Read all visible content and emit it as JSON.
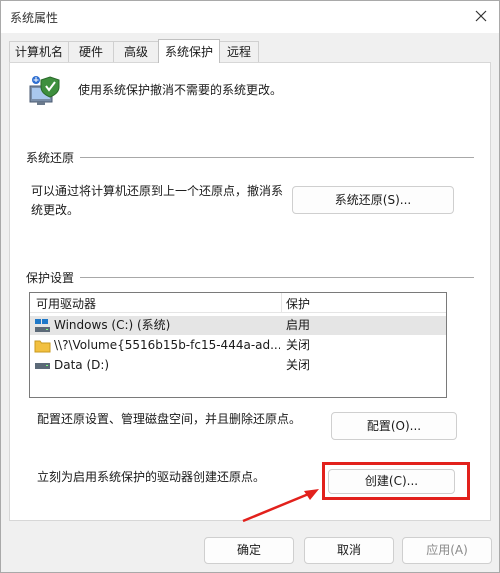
{
  "window": {
    "title": "系统属性"
  },
  "tabs": [
    {
      "label": "计算机名"
    },
    {
      "label": "硬件"
    },
    {
      "label": "高级"
    },
    {
      "label": "系统保护"
    },
    {
      "label": "远程"
    }
  ],
  "intro": {
    "text": "使用系统保护撤消不需要的系统更改。",
    "icon": "system-protection-shield-icon"
  },
  "restore": {
    "heading": "系统还原",
    "description_line1": "可以通过将计算机还原到上一个还原点，撤消系",
    "description_line2": "统更改。",
    "button": "系统还原(S)..."
  },
  "protection": {
    "heading": "保护设置",
    "columns": {
      "drive": "可用驱动器",
      "protection": "保护"
    },
    "drives": [
      {
        "name": "Windows (C:) (系统)",
        "protection": "启用",
        "icon": "system-drive-icon"
      },
      {
        "name": "\\\\?\\Volume{5516b15b-fc15-444a-ad...",
        "protection": "关闭",
        "icon": "folder-icon"
      },
      {
        "name": "Data (D:)",
        "protection": "关闭",
        "icon": "drive-icon"
      }
    ],
    "configure_text": "配置还原设置、管理磁盘空间，并且删除还原点。",
    "configure_button": "配置(O)...",
    "create_text": "立刻为启用系统保护的驱动器创建还原点。",
    "create_button": "创建(C)..."
  },
  "footer": {
    "ok": "确定",
    "cancel": "取消",
    "apply": "应用(A)"
  },
  "colors": {
    "highlight": "#e2211c",
    "selected_row": "#e5e5e5"
  }
}
